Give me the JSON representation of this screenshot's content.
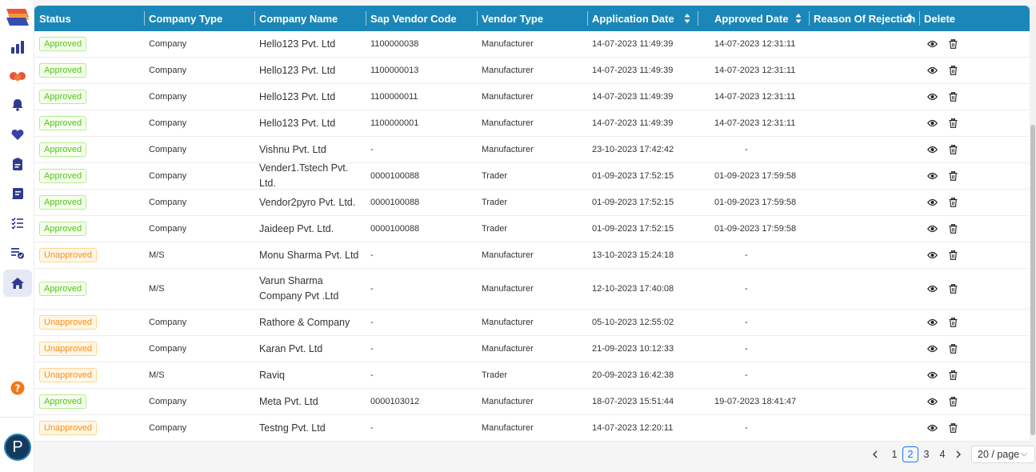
{
  "sidebar": {
    "items": [
      {
        "name": "dashboard-chart-icon"
      },
      {
        "name": "handshake-icon"
      },
      {
        "name": "bell-icon"
      },
      {
        "name": "heart-icon"
      },
      {
        "name": "clipboard-icon"
      },
      {
        "name": "document-icon"
      },
      {
        "name": "checklist-icon"
      },
      {
        "name": "approved-list-icon"
      },
      {
        "name": "home-icon",
        "active": true
      }
    ],
    "help_icon": "question-circle-icon",
    "avatar_initial": "P"
  },
  "colors": {
    "header_bg": "#1b87b8",
    "sidebar_icon": "#2f3a8f",
    "approved": "#52c41a",
    "unapproved": "#fa8c16",
    "accent": "#1677ff"
  },
  "table": {
    "columns": [
      "Status",
      "Company Type",
      "Company Name",
      "Sap Vendor Code",
      "Vendor Type",
      "Application Date",
      "Approved Date",
      "Reason Of Rejection",
      "Delete"
    ],
    "rows": [
      {
        "status": "Approved",
        "company_type": "Company",
        "company_name": "Hello123 Pvt. Ltd",
        "sap_code": "1100000038",
        "vendor_type": "Manufacturer",
        "application_date": "14-07-2023 11:49:39",
        "approved_date": "14-07-2023 12:31:11"
      },
      {
        "status": "Approved",
        "company_type": "Company",
        "company_name": "Hello123 Pvt. Ltd",
        "sap_code": "1100000013",
        "vendor_type": "Manufacturer",
        "application_date": "14-07-2023 11:49:39",
        "approved_date": "14-07-2023 12:31:11"
      },
      {
        "status": "Approved",
        "company_type": "Company",
        "company_name": "Hello123 Pvt. Ltd",
        "sap_code": "1100000011",
        "vendor_type": "Manufacturer",
        "application_date": "14-07-2023 11:49:39",
        "approved_date": "14-07-2023 12:31:11"
      },
      {
        "status": "Approved",
        "company_type": "Company",
        "company_name": "Hello123 Pvt. Ltd",
        "sap_code": "1100000001",
        "vendor_type": "Manufacturer",
        "application_date": "14-07-2023 11:49:39",
        "approved_date": "14-07-2023 12:31:11"
      },
      {
        "status": "Approved",
        "company_type": "Company",
        "company_name": "Vishnu Pvt. Ltd",
        "sap_code": "-",
        "vendor_type": "Manufacturer",
        "application_date": "23-10-2023 17:42:42",
        "approved_date": "-"
      },
      {
        "status": "Approved",
        "company_type": "Company",
        "company_name": "Vender1.Tstech Pvt. Ltd.",
        "sap_code": "0000100088",
        "vendor_type": "Trader",
        "application_date": "01-09-2023 17:52:15",
        "approved_date": "01-09-2023 17:59:58"
      },
      {
        "status": "Approved",
        "company_type": "Company",
        "company_name": "Vendor2pyro Pvt. Ltd.",
        "sap_code": "0000100088",
        "vendor_type": "Trader",
        "application_date": "01-09-2023 17:52:15",
        "approved_date": "01-09-2023 17:59:58"
      },
      {
        "status": "Approved",
        "company_type": "Company",
        "company_name": "Jaideep Pvt. Ltd.",
        "sap_code": "0000100088",
        "vendor_type": "Trader",
        "application_date": "01-09-2023 17:52:15",
        "approved_date": "01-09-2023 17:59:58"
      },
      {
        "status": "Unapproved",
        "company_type": "M/S",
        "company_name": "Monu Sharma Pvt. Ltd",
        "sap_code": "-",
        "vendor_type": "Manufacturer",
        "application_date": "13-10-2023 15:24:18",
        "approved_date": "-"
      },
      {
        "status": "Approved",
        "company_type": "M/S",
        "company_name": "Varun Sharma Company Pvt .Ltd",
        "sap_code": "-",
        "vendor_type": "Manufacturer",
        "application_date": "12-10-2023 17:40:08",
        "approved_date": "-"
      },
      {
        "status": "Unapproved",
        "company_type": "Company",
        "company_name": "Rathore & Company",
        "sap_code": "-",
        "vendor_type": "Manufacturer",
        "application_date": "05-10-2023 12:55:02",
        "approved_date": "-"
      },
      {
        "status": "Unapproved",
        "company_type": "Company",
        "company_name": "Karan Pvt. Ltd",
        "sap_code": "-",
        "vendor_type": "Manufacturer",
        "application_date": "21-09-2023 10:12:33",
        "approved_date": "-"
      },
      {
        "status": "Unapproved",
        "company_type": "M/S",
        "company_name": "Raviq",
        "sap_code": "-",
        "vendor_type": "Trader",
        "application_date": "20-09-2023 16:42:38",
        "approved_date": "-"
      },
      {
        "status": "Approved",
        "company_type": "Company",
        "company_name": "Meta Pvt. Ltd",
        "sap_code": "0000103012",
        "vendor_type": "Manufacturer",
        "application_date": "18-07-2023 15:51:44",
        "approved_date": "19-07-2023 18:41:47"
      },
      {
        "status": "Unapproved",
        "company_type": "Company",
        "company_name": "Testng Pvt. Ltd",
        "sap_code": "-",
        "vendor_type": "Manufacturer",
        "application_date": "14-07-2023 12:20:11",
        "approved_date": "-"
      }
    ]
  },
  "pagination": {
    "pages": [
      "1",
      "2",
      "3",
      "4"
    ],
    "current": "2",
    "page_size": "20 / page"
  }
}
